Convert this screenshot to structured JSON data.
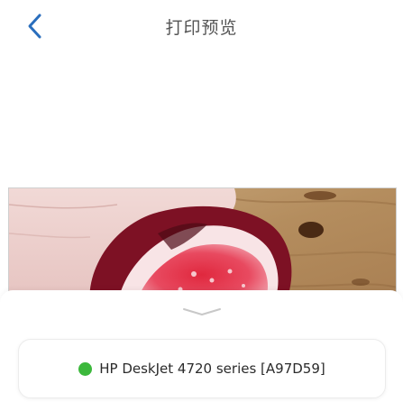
{
  "header": {
    "title": "打印预览",
    "back_icon": "chevron-left-icon",
    "accent_color": "#2a6ebd"
  },
  "preview": {
    "image_subject": "photo of a halved fig held in a hand over a wooden table"
  },
  "sheet": {
    "handle_icon": "chevron-down-icon",
    "printer": {
      "name": "HP DeskJet 4720 series [A97D59]",
      "status_color": "#3cb83c"
    }
  }
}
